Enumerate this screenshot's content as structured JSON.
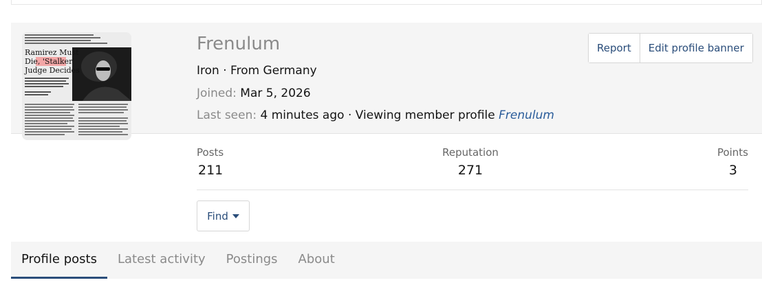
{
  "profile": {
    "username": "Frenulum",
    "rank": "Iron",
    "separator": " · ",
    "location": "From Germany",
    "joined_label": "Joined:",
    "joined_value": "Mar 5, 2026",
    "last_seen_label": "Last seen:",
    "last_seen_value": "4 minutes ago",
    "activity_text": "Viewing member profile",
    "activity_link": "Frenulum"
  },
  "avatar": {
    "icon": "newspaper-clipping-avatar",
    "headline": "Ramirez Must Die, 'Stalker' Judge Decides",
    "highlight_color": "#f2a6a6"
  },
  "actions": {
    "report_label": "Report",
    "edit_banner_label": "Edit profile banner"
  },
  "stats": {
    "posts_label": "Posts",
    "posts_value": "211",
    "reputation_label": "Reputation",
    "reputation_value": "271",
    "points_label": "Points",
    "points_value": "3"
  },
  "find": {
    "label": "Find",
    "icon": "caret-down-icon"
  },
  "tabs": [
    {
      "label": "Profile posts",
      "active": true
    },
    {
      "label": "Latest activity",
      "active": false
    },
    {
      "label": "Postings",
      "active": false
    },
    {
      "label": "About",
      "active": false
    }
  ],
  "colors": {
    "accent": "#2a4d7a",
    "link": "#2a5c9a",
    "muted": "#8a8a8a",
    "panel": "#f5f5f5"
  }
}
